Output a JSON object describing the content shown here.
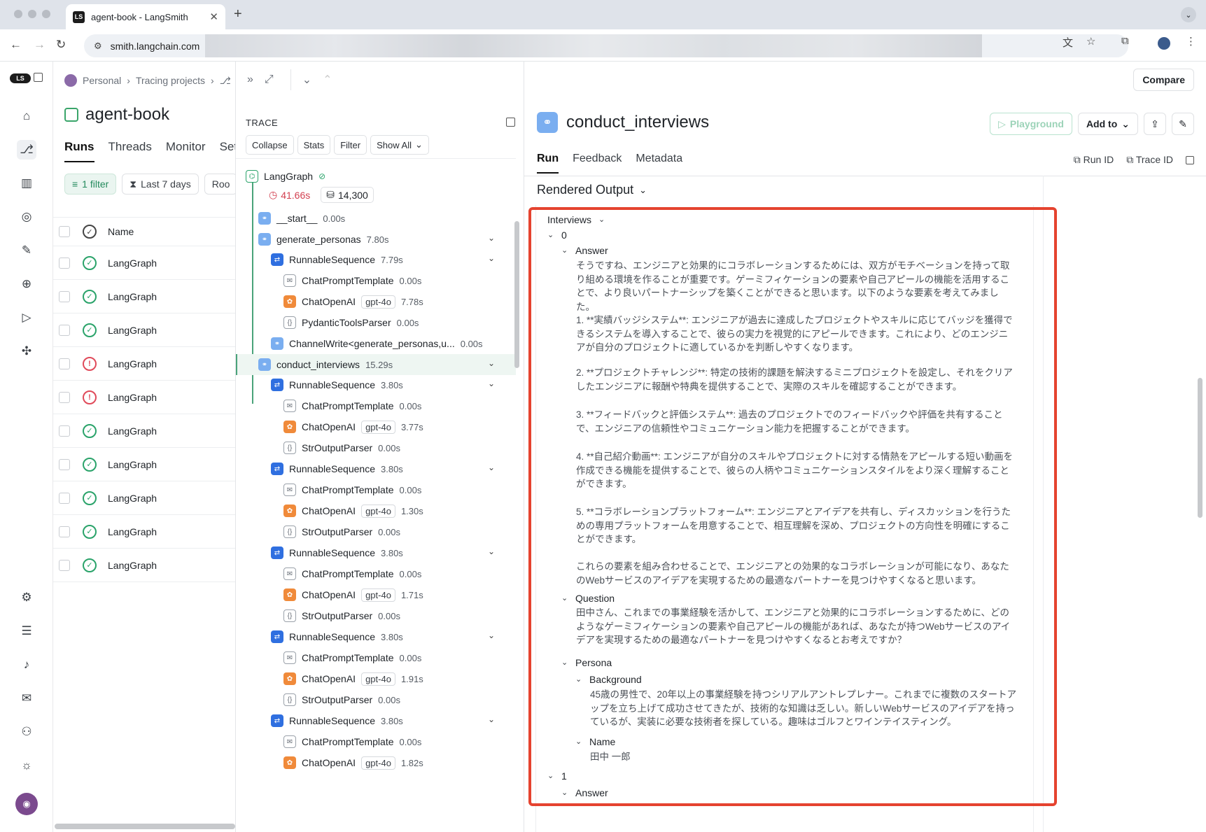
{
  "browser": {
    "tab_title": "agent-book - LangSmith",
    "favicon_text": "LS",
    "url": "smith.langchain.com"
  },
  "runs_panel": {
    "breadcrumb": [
      "Personal",
      "Tracing projects"
    ],
    "project_title": "agent-book",
    "tabs": [
      "Runs",
      "Threads",
      "Monitor",
      "Set"
    ],
    "filters": [
      "1 filter",
      "Last 7 days",
      "Roo"
    ],
    "column_name": "Name",
    "rows": [
      {
        "name": "LangGraph",
        "status": "success"
      },
      {
        "name": "LangGraph",
        "status": "success"
      },
      {
        "name": "LangGraph",
        "status": "success"
      },
      {
        "name": "LangGraph",
        "status": "error"
      },
      {
        "name": "LangGraph",
        "status": "error"
      },
      {
        "name": "LangGraph",
        "status": "success"
      },
      {
        "name": "LangGraph",
        "status": "success"
      },
      {
        "name": "LangGraph",
        "status": "success"
      },
      {
        "name": "LangGraph",
        "status": "success"
      },
      {
        "name": "LangGraph",
        "status": "success"
      }
    ]
  },
  "trace": {
    "label": "TRACE",
    "buttons": [
      "Collapse",
      "Stats",
      "Filter",
      "Show All"
    ],
    "root": {
      "name": "LangGraph",
      "latency": "41.66s",
      "tokens": "14,300"
    },
    "nodes": [
      {
        "name": "__start__",
        "time": "0.00s",
        "type": "chain",
        "indent": 0
      },
      {
        "name": "generate_personas",
        "time": "7.80s",
        "type": "chain",
        "indent": 0
      },
      {
        "name": "RunnableSequence",
        "time": "7.79s",
        "type": "seq",
        "indent": 1
      },
      {
        "name": "ChatPromptTemplate",
        "time": "0.00s",
        "type": "prompt",
        "indent": 2
      },
      {
        "name": "ChatOpenAI",
        "model": "gpt-4o",
        "time": "7.78s",
        "type": "openai",
        "indent": 2
      },
      {
        "name": "PydanticToolsParser",
        "time": "0.00s",
        "type": "parser",
        "indent": 2
      },
      {
        "name": "ChannelWrite<generate_personas,u...",
        "time": "0.00s",
        "type": "chain",
        "indent": 1
      },
      {
        "name": "conduct_interviews",
        "time": "15.29s",
        "type": "chain",
        "indent": 0
      },
      {
        "name": "RunnableSequence",
        "time": "3.80s",
        "type": "seq",
        "indent": 1
      },
      {
        "name": "ChatPromptTemplate",
        "time": "0.00s",
        "type": "prompt",
        "indent": 2
      },
      {
        "name": "ChatOpenAI",
        "model": "gpt-4o",
        "time": "3.77s",
        "type": "openai",
        "indent": 2
      },
      {
        "name": "StrOutputParser",
        "time": "0.00s",
        "type": "parser",
        "indent": 2
      },
      {
        "name": "RunnableSequence",
        "time": "3.80s",
        "type": "seq",
        "indent": 1
      },
      {
        "name": "ChatPromptTemplate",
        "time": "0.00s",
        "type": "prompt",
        "indent": 2
      },
      {
        "name": "ChatOpenAI",
        "model": "gpt-4o",
        "time": "1.30s",
        "type": "openai",
        "indent": 2
      },
      {
        "name": "StrOutputParser",
        "time": "0.00s",
        "type": "parser",
        "indent": 2
      },
      {
        "name": "RunnableSequence",
        "time": "3.80s",
        "type": "seq",
        "indent": 1
      },
      {
        "name": "ChatPromptTemplate",
        "time": "0.00s",
        "type": "prompt",
        "indent": 2
      },
      {
        "name": "ChatOpenAI",
        "model": "gpt-4o",
        "time": "1.71s",
        "type": "openai",
        "indent": 2
      },
      {
        "name": "StrOutputParser",
        "time": "0.00s",
        "type": "parser",
        "indent": 2
      },
      {
        "name": "RunnableSequence",
        "time": "3.80s",
        "type": "seq",
        "indent": 1
      },
      {
        "name": "ChatPromptTemplate",
        "time": "0.00s",
        "type": "prompt",
        "indent": 2
      },
      {
        "name": "ChatOpenAI",
        "model": "gpt-4o",
        "time": "1.91s",
        "type": "openai",
        "indent": 2
      },
      {
        "name": "StrOutputParser",
        "time": "0.00s",
        "type": "parser",
        "indent": 2
      },
      {
        "name": "RunnableSequence",
        "time": "3.80s",
        "type": "seq",
        "indent": 1
      },
      {
        "name": "ChatPromptTemplate",
        "time": "0.00s",
        "type": "prompt",
        "indent": 2
      },
      {
        "name": "ChatOpenAI",
        "model": "gpt-4o",
        "time": "1.82s",
        "type": "openai",
        "indent": 2
      }
    ]
  },
  "detail": {
    "compare": "Compare",
    "title": "conduct_interviews",
    "actions": {
      "playground": "Playground",
      "add_to": "Add to"
    },
    "tabs": [
      "Run",
      "Feedback",
      "Metadata"
    ],
    "run_id": "Run ID",
    "trace_id": "Trace ID",
    "output_mode": "Rendered Output",
    "output": {
      "interviews_key": "Interviews",
      "index0": "0",
      "answer_key": "Answer",
      "answer_paragraphs": [
        "そうですね、エンジニアと効果的にコラボレーションするためには、双方がモチベーションを持って取り組める環境を作ることが重要です。ゲーミフィケーションの要素や自己アピールの機能を活用することで、より良いパートナーシップを築くことができると思います。以下のような要素を考えてみました。",
        "1. **実績バッジシステム**: エンジニアが過去に達成したプロジェクトやスキルに応じてバッジを獲得できるシステムを導入することで、彼らの実力を視覚的にアピールできます。これにより、どのエンジニアが自分のプロジェクトに適しているかを判断しやすくなります。",
        "2. **プロジェクトチャレンジ**: 特定の技術的課題を解決するミニプロジェクトを設定し、それをクリアしたエンジニアに報酬や特典を提供することで、実際のスキルを確認することができます。",
        "3. **フィードバックと評価システム**: 過去のプロジェクトでのフィードバックや評価を共有することで、エンジニアの信頼性やコミュニケーション能力を把握することができます。",
        "4. **自己紹介動画**: エンジニアが自分のスキルやプロジェクトに対する情熱をアピールする短い動画を作成できる機能を提供することで、彼らの人柄やコミュニケーションスタイルをより深く理解することができます。",
        "5. **コラボレーションプラットフォーム**: エンジニアとアイデアを共有し、ディスカッションを行うための専用プラットフォームを用意することで、相互理解を深め、プロジェクトの方向性を明確にすることができます。",
        "これらの要素を組み合わせることで、エンジニアとの効果的なコラボレーションが可能になり、あなたのWebサービスのアイデアを実現するための最適なパートナーを見つけやすくなると思います。"
      ],
      "question_key": "Question",
      "question": "田中さん、これまでの事業経験を活かして、エンジニアと効果的にコラボレーションするために、どのようなゲーミフィケーションの要素や自己アピールの機能があれば、あなたが持つWebサービスのアイデアを実現するための最適なパートナーを見つけやすくなるとお考えですか？",
      "persona_key": "Persona",
      "background_key": "Background",
      "background": "45歳の男性で、20年以上の事業経験を持つシリアルアントレプレナー。これまでに複数のスタートアップを立ち上げて成功させてきたが、技術的な知識は乏しい。新しいWebサービスのアイデアを持っているが、実装に必要な技術者を探している。趣味はゴルフとワインテイスティング。",
      "name_key": "Name",
      "name": "田中 一郎",
      "index1": "1",
      "answer_key_2": "Answer"
    }
  },
  "colors": {
    "accent_green": "#2aa36a",
    "error_red": "#e04a5a",
    "highlight": "#e5432f",
    "openai": "#f08a3a",
    "seq_blue": "#2f6fe0"
  }
}
